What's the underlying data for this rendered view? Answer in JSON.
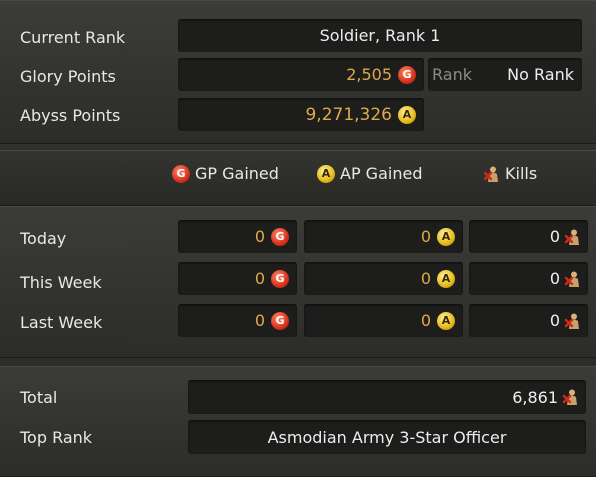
{
  "summary": {
    "current_rank_label": "Current Rank",
    "current_rank_value": "Soldier, Rank 1",
    "glory_points_label": "Glory Points",
    "glory_points_value": "2,505",
    "rank_label": "Rank",
    "rank_value": "No Rank",
    "abyss_points_label": "Abyss Points",
    "abyss_points_value": "9,271,326"
  },
  "columns": {
    "gp_gained": "GP Gained",
    "ap_gained": "AP Gained",
    "kills": "Kills"
  },
  "icons": {
    "gp": "G",
    "ap": "A",
    "kills": "kills-icon"
  },
  "rows": [
    {
      "label": "Today",
      "gp": "0",
      "ap": "0",
      "kills": "0"
    },
    {
      "label": "This Week",
      "gp": "0",
      "ap": "0",
      "kills": "0"
    },
    {
      "label": "Last Week",
      "gp": "0",
      "ap": "0",
      "kills": "0"
    }
  ],
  "totals": {
    "total_label": "Total",
    "total_value": "6,861",
    "top_rank_label": "Top Rank",
    "top_rank_value": "Asmodian Army 3-Star Officer"
  },
  "colors": {
    "gold_value": "#e0a94a",
    "gp_icon": "#d6321c",
    "ap_icon": "#e5b915"
  }
}
